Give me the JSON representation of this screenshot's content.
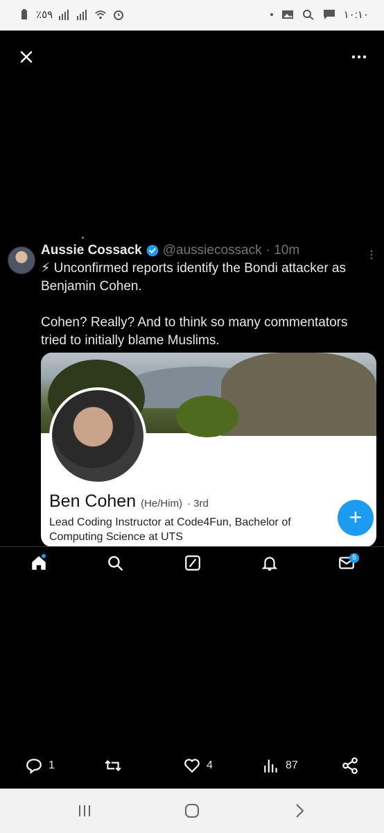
{
  "status_bar": {
    "battery": "٪٥٩",
    "time": "١٠:١٠"
  },
  "tweet": {
    "author_name": "Aussie Cossack",
    "handle": "@aussiecossack",
    "time": "· 10m",
    "text": "⚡ Unconfirmed reports identify the Bondi attacker as Benjamin Cohen.\n\nCohen? Really? And to think so many commentators tried to initially blame Muslims."
  },
  "card": {
    "name": "Ben Cohen",
    "pronouns": "(He/Him)",
    "degree": "· 3rd",
    "description": "Lead Coding Instructor at Code4Fun, Bachelor of Computing Science at UTS"
  },
  "fab": {
    "label": "+"
  },
  "bottom_nav": {
    "messages_badge": "5"
  },
  "actions": {
    "replies": "1",
    "likes": "4",
    "views": "87"
  },
  "colors": {
    "accent": "#1d9bf0",
    "background": "#000000"
  }
}
